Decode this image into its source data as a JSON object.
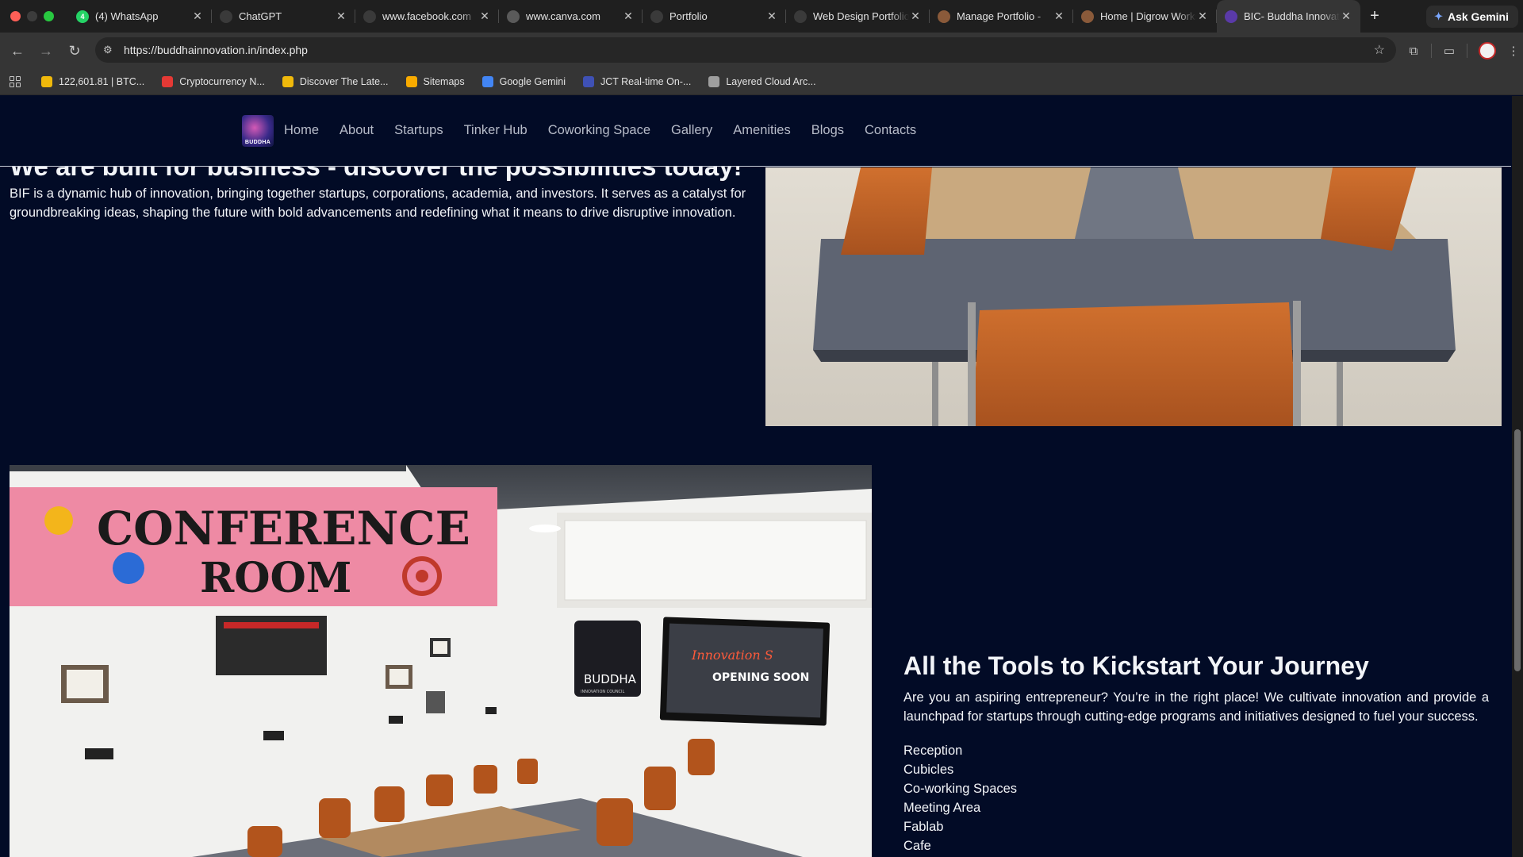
{
  "browser": {
    "tabs": [
      {
        "title": "(4) WhatsApp",
        "icon": "whatsapp-icon",
        "badge": "4",
        "color": "#25d366"
      },
      {
        "title": "ChatGPT",
        "icon": "chatgpt-icon",
        "color": "#3a3a3a"
      },
      {
        "title": "www.facebook.com",
        "icon": "meta-icon",
        "color": "#3a3a3a"
      },
      {
        "title": "www.canva.com",
        "icon": "canva-icon",
        "color": "#5a5a5a"
      },
      {
        "title": "Portfolio",
        "icon": "portfolio-icon",
        "color": "#3a3a3a"
      },
      {
        "title": "Web Design Portfolio",
        "icon": "portfolio-icon",
        "color": "#3a3a3a"
      },
      {
        "title": "Manage Portfolio -",
        "icon": "profile-icon",
        "color": "#8a5a3a"
      },
      {
        "title": "Home | Digrow Works",
        "icon": "profile-icon",
        "color": "#8a5a3a"
      },
      {
        "title": "BIC- Buddha Innovation",
        "icon": "buddha-icon",
        "color": "#5a3aa8",
        "active": true
      }
    ],
    "ask_gemini": "Ask Gemini",
    "url": "https://buddhainnovation.in/index.php",
    "bookmarks": [
      {
        "label": "122,601.81 | BTC...",
        "icon": "binance-icon",
        "color": "#f0b90b"
      },
      {
        "label": "Cryptocurrency N...",
        "icon": "news-icon",
        "color": "#e53935"
      },
      {
        "label": "Discover The Late...",
        "icon": "binance-icon",
        "color": "#f0b90b"
      },
      {
        "label": "Sitemaps",
        "icon": "analytics-icon",
        "color": "#f9ab00"
      },
      {
        "label": "Google Gemini",
        "icon": "gemini-icon",
        "color": "#4285f4"
      },
      {
        "label": "JCT Real-time On-...",
        "icon": "jct-icon",
        "color": "#3f51b5"
      },
      {
        "label": "Layered Cloud Arc...",
        "icon": "cloud-icon",
        "color": "#9e9e9e"
      }
    ]
  },
  "site": {
    "logo_text": "BUDDHA",
    "menu": [
      "Home",
      "About",
      "Startups",
      "Tinker Hub",
      "Coworking Space",
      "Gallery",
      "Amenities",
      "Blogs",
      "Contacts"
    ],
    "hero_heading_cut": "We are built for business - discover the possibilities today!",
    "intro": "BIF is a dynamic hub of innovation, bringing together startups, corporations, academia, and investors. It serves as a catalyst for groundbreaking ideas, shaping the future with bold advancements and redefining what it means to drive disruptive innovation.",
    "conference": {
      "sign_line1": "CONFERENCE",
      "sign_line2": "ROOM",
      "tv_text1": "Innovation S",
      "tv_text2": "OPENING SOON",
      "poster_logo": "BUDDHA",
      "poster_sub": "INNOVATION COUNCIL"
    },
    "tools": {
      "title": "All the Tools to Kickstart Your Journey",
      "description": "Are you an aspiring entrepreneur? You’re in the right place! We cultivate innovation and provide a launchpad for startups through cutting-edge programs and initiatives designed to fuel your success.",
      "items": [
        "Reception",
        "Cubicles",
        "Co-working Spaces",
        "Meeting Area",
        "Fablab",
        "Cafe"
      ]
    }
  }
}
